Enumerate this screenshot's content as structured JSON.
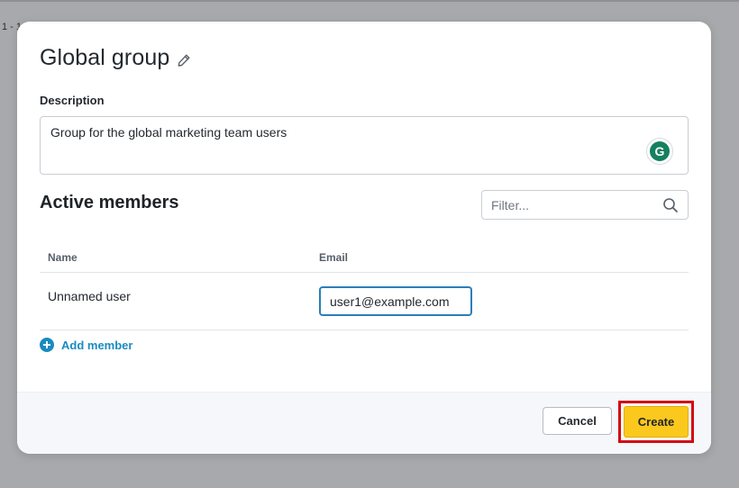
{
  "backdrop": {
    "partial_text": "1 - 1"
  },
  "dialog": {
    "title": "Global group",
    "description_label": "Description",
    "description_value": "Group for the global marketing team users",
    "grammarly_letter": "G"
  },
  "members": {
    "title": "Active members",
    "filter_placeholder": "Filter...",
    "columns": {
      "name": "Name",
      "email": "Email"
    },
    "rows": [
      {
        "name": "Unnamed user",
        "email": "user1@example.com"
      }
    ],
    "add_label": "Add member"
  },
  "footer": {
    "cancel_label": "Cancel",
    "create_label": "Create"
  },
  "colors": {
    "accent_blue": "#1a8bbf",
    "primary_yellow": "#fbc81d",
    "highlight_red": "#d20a11",
    "grammarly_green": "#15805f"
  },
  "icons": [
    "pencil-icon",
    "grammarly-icon",
    "search-icon",
    "plus-circle-icon"
  ]
}
